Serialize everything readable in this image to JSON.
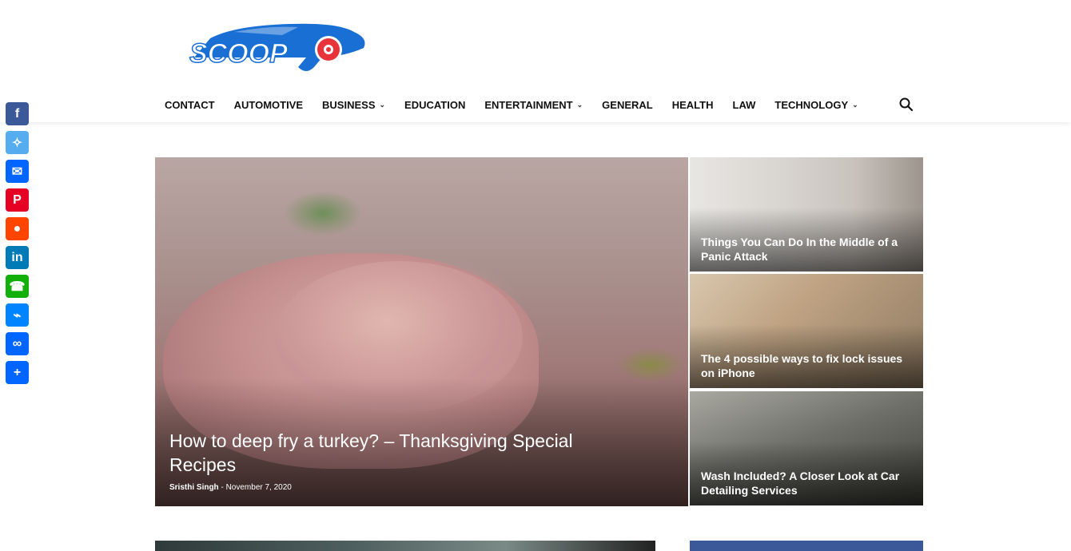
{
  "header": {
    "logo_text": "SCOOP",
    "nav": [
      {
        "label": "CONTACT",
        "has_dropdown": false
      },
      {
        "label": "AUTOMOTIVE",
        "has_dropdown": false
      },
      {
        "label": "BUSINESS",
        "has_dropdown": true
      },
      {
        "label": "EDUCATION",
        "has_dropdown": false
      },
      {
        "label": "ENTERTAINMENT",
        "has_dropdown": true
      },
      {
        "label": "GENERAL",
        "has_dropdown": false
      },
      {
        "label": "HEALTH",
        "has_dropdown": false
      },
      {
        "label": "LAW",
        "has_dropdown": false
      },
      {
        "label": "TECHNOLOGY",
        "has_dropdown": true
      }
    ],
    "search_icon": "search-icon"
  },
  "share_bar": [
    {
      "name": "facebook",
      "icon": "facebook-icon",
      "color": "#3b5998"
    },
    {
      "name": "twitter",
      "icon": "twitter-icon",
      "color": "#55acee"
    },
    {
      "name": "email",
      "icon": "email-icon",
      "color": "#0166ff"
    },
    {
      "name": "pinterest",
      "icon": "pinterest-icon",
      "color": "#e60023"
    },
    {
      "name": "reddit",
      "icon": "reddit-icon",
      "color": "#ff4500"
    },
    {
      "name": "linkedin",
      "icon": "linkedin-icon",
      "color": "#007bb5"
    },
    {
      "name": "whatsapp",
      "icon": "whatsapp-icon",
      "color": "#12af0a"
    },
    {
      "name": "messenger",
      "icon": "messenger-icon",
      "color": "#0084ff"
    },
    {
      "name": "copy-link",
      "icon": "link-icon",
      "color": "#0166ff"
    },
    {
      "name": "share",
      "icon": "plus-icon",
      "color": "#0166ff"
    }
  ],
  "featured": {
    "title": "How to deep fry a turkey? – Thanksgiving Special Recipes",
    "author": "Sristhi Singh",
    "separator": "-",
    "date": "November 7, 2020"
  },
  "side_posts": [
    {
      "title": "Things You Can Do In the Middle of a Panic Attack"
    },
    {
      "title": "The 4 possible ways to fix lock issues on iPhone"
    },
    {
      "title": "Wash Included? A Closer Look at Car Detailing Services"
    }
  ],
  "colors": {
    "logo_blue": "#1a6fd4",
    "logo_red": "#e8333a",
    "nav_text": "#111111"
  }
}
